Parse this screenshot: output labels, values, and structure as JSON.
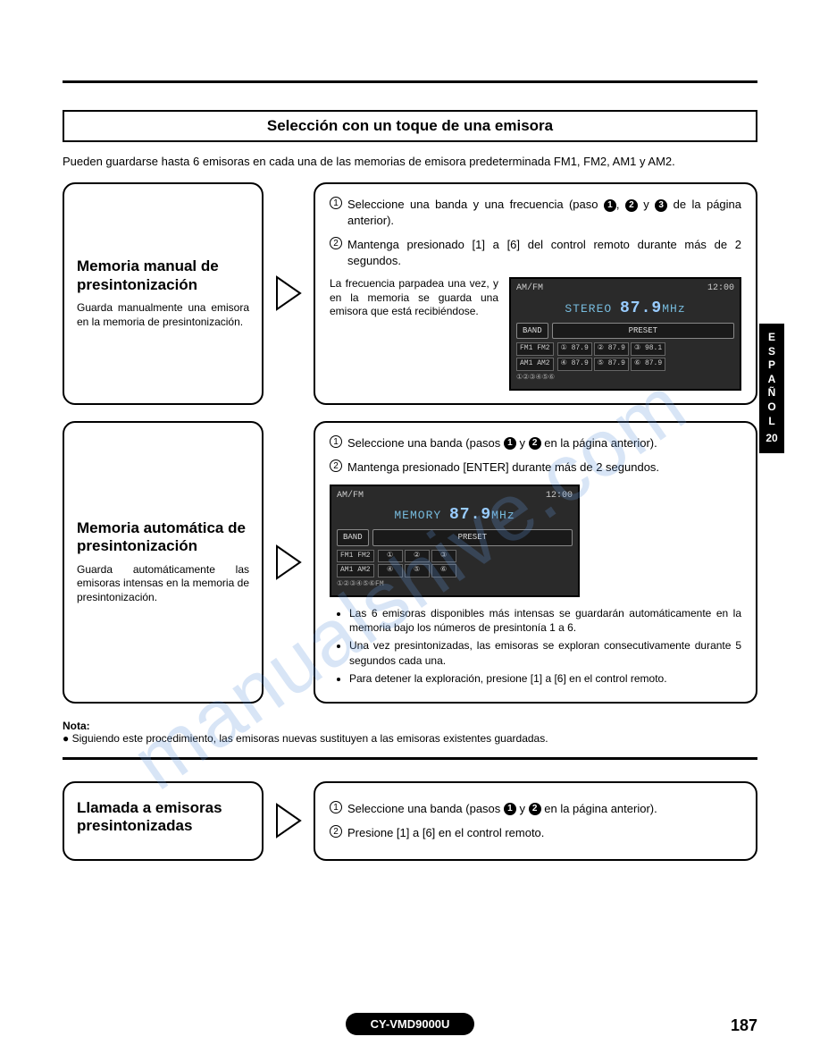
{
  "title": "Selección con un toque de una emisora",
  "intro": "Pueden guardarse hasta 6 emisoras en cada una de las memorias de emisora predeterminada FM1, FM2, AM1 y AM2.",
  "section1": {
    "title": "Memoria manual de presintonización",
    "desc": "Guarda manualmente una emisora en la memoria de presintonización.",
    "step1_a": "Seleccione una banda y una frecuencia (paso ",
    "step1_b": ", ",
    "step1_c": " y ",
    "step1_d": " de la página anterior).",
    "step2": "Mantenga presionado [1] a [6] del control remoto durante más de 2 segundos.",
    "caption": "La frecuencia parpadea una vez, y en la memoria se guarda una emisora que está recibiéndose."
  },
  "section2": {
    "title": "Memoria automática de presintonización",
    "desc": "Guarda automáticamente las emisoras intensas en la memoria de presintonización.",
    "step1_a": "Seleccione una banda (pasos ",
    "step1_b": " y ",
    "step1_c": " en la página anterior).",
    "step2": "Mantenga presionado [ENTER] durante más de 2 segundos.",
    "b1": "Las 6 emisoras disponibles más intensas se guardarán automáticamente en la memoria bajo los números de presintonía 1 a 6.",
    "b2": "Una vez presintonizadas, las emisoras se exploran consecutivamente durante 5 segundos cada una.",
    "b3": "Para detener la exploración, presione [1] a [6] en el control remoto."
  },
  "note": {
    "label": "Nota:",
    "text": "Siguiendo este procedimiento, las emisoras nuevas sustituyen a las emisoras existentes guardadas."
  },
  "section3": {
    "title": "Llamada a emisoras presintonizadas",
    "step1_a": "Seleccione una banda (pasos ",
    "step1_b": " y ",
    "step1_c": " en la página anterior).",
    "step2": "Presione [1] a [6] en el control remoto."
  },
  "lcd1": {
    "top_left": "AM/FM",
    "top_right": "12:00",
    "stereo": "STEREO",
    "freq_big": "87.9",
    "freq_unit": "MHz",
    "band": "BAND",
    "preset": "PRESET",
    "fm": "FM1 FM2",
    "am": "AM1 AM2",
    "p1": "① 87.9",
    "p2": "② 87.9",
    "p3": "③ 98.1",
    "p4": "④ 87.9",
    "p5": "⑤ 87.9",
    "p6": "⑥ 87.9",
    "footer": "①②③④⑤⑥"
  },
  "lcd2": {
    "top_left": "AM/FM",
    "top_right": "12:00",
    "memory": "MEMORY",
    "freq_big": "87.9",
    "freq_unit": "MHz",
    "band": "BAND",
    "preset": "PRESET",
    "fm": "FM1 FM2",
    "am": "AM1 AM2",
    "p1": "①",
    "p2": "②",
    "p3": "③",
    "p4": "④",
    "p5": "⑤",
    "p6": "⑥",
    "footer": "①②③④⑤⑥FM"
  },
  "sidetab": {
    "l1": "E",
    "l2": "S",
    "l3": "P",
    "l4": "A",
    "l5": "Ñ",
    "l6": "O",
    "l7": "L",
    "num": "20"
  },
  "footer_model": "CY-VMD9000U",
  "page": "187",
  "watermark": "manualshive.com"
}
